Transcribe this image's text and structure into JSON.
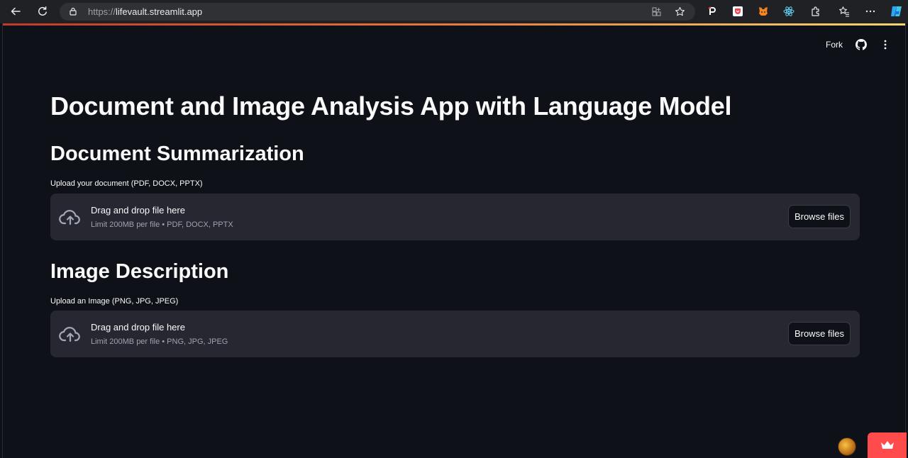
{
  "browser": {
    "url_protocol": "https://",
    "url_host": "lifevault.streamlit.app"
  },
  "toolbar": {
    "fork_label": "Fork"
  },
  "app": {
    "title": "Document and Image Analysis App with Language Model",
    "sections": [
      {
        "heading": "Document Summarization",
        "uploader_label": "Upload your document (PDF, DOCX, PPTX)",
        "drop_text": "Drag and drop file here",
        "limit_text": "Limit 200MB per file • PDF, DOCX, PPTX",
        "browse_label": "Browse files"
      },
      {
        "heading": "Image Description",
        "uploader_label": "Upload an Image (PNG, JPG, JPEG)",
        "drop_text": "Drag and drop file here",
        "limit_text": "Limit 200MB per file • PNG, JPG, JPEG",
        "browse_label": "Browse files"
      }
    ]
  },
  "colors": {
    "background": "#0e1117",
    "dropzone": "#262730",
    "accent": "#ff4b4b"
  }
}
